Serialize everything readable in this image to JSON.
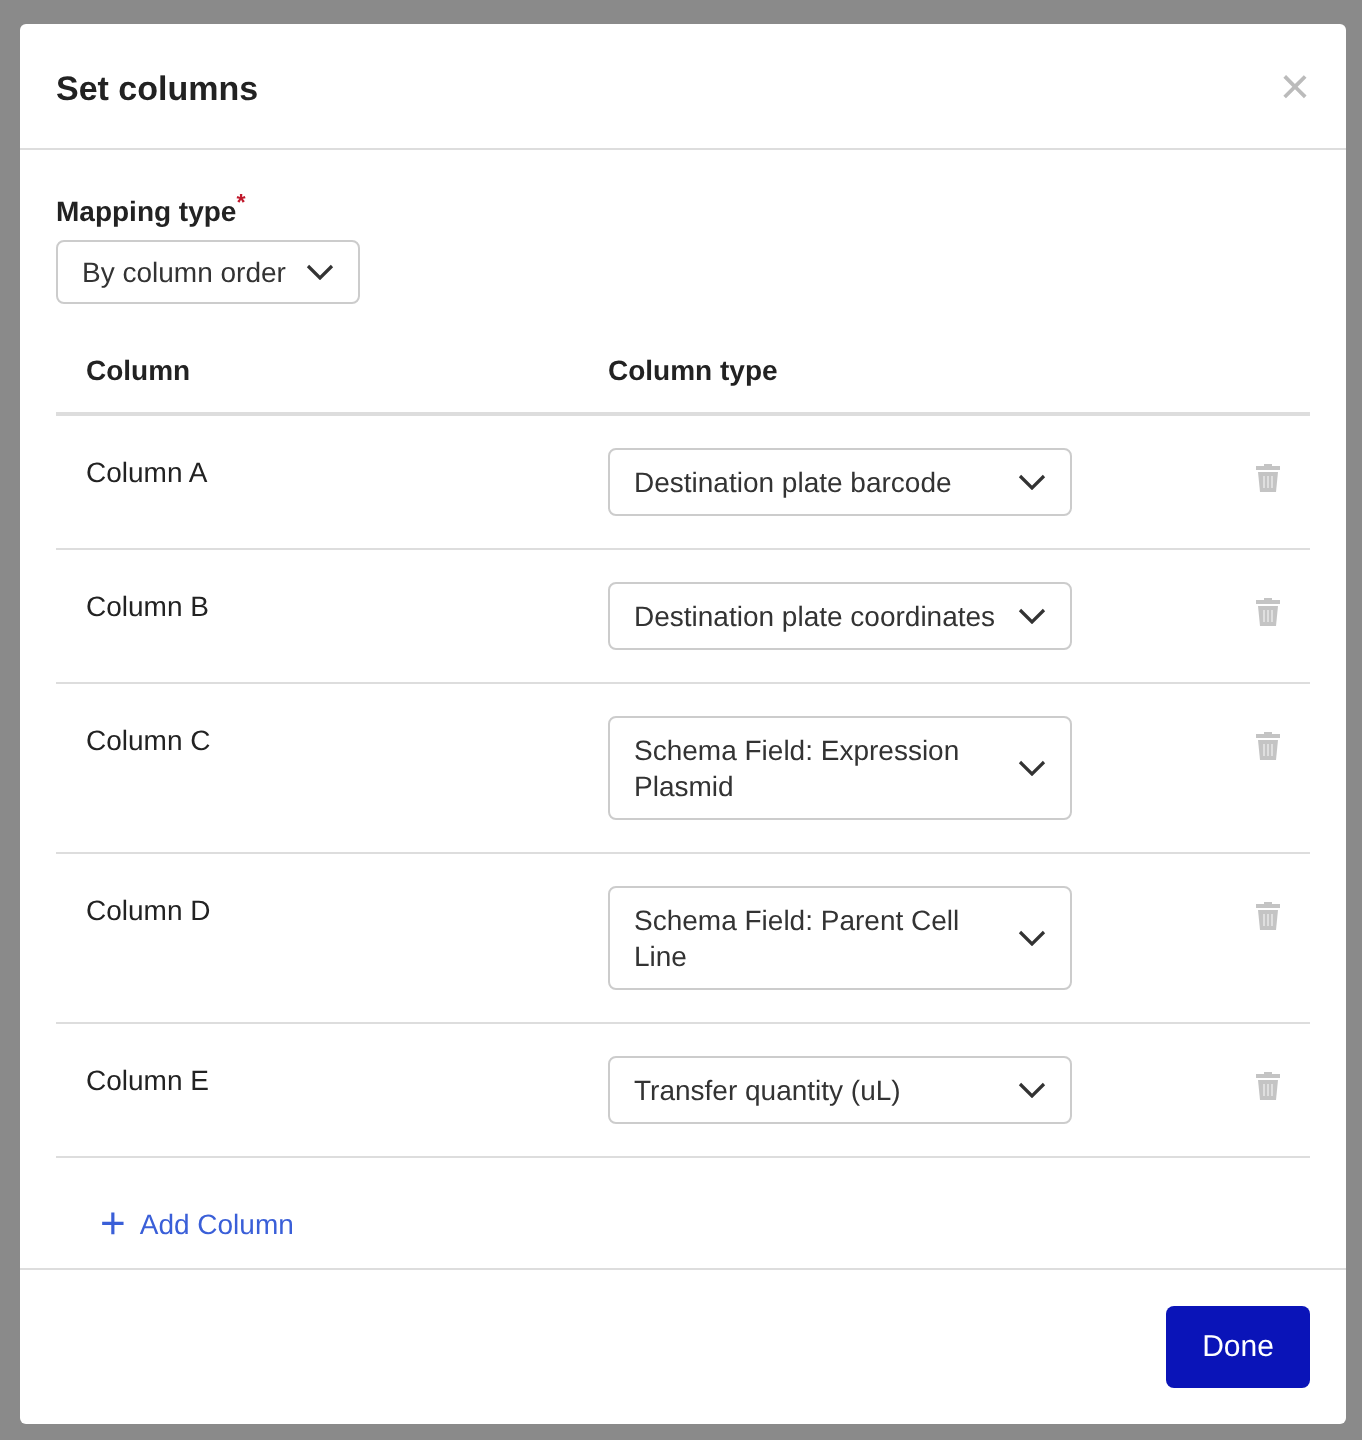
{
  "dialog": {
    "title": "Set columns",
    "close": "×"
  },
  "mapping_type": {
    "label": "Mapping type",
    "required_marker": "*",
    "value": "By column order"
  },
  "table": {
    "columns": [
      "Column",
      "Column type"
    ],
    "rows": [
      {
        "column": "Column A",
        "column_type": "Destination plate barcode"
      },
      {
        "column": "Column B",
        "column_type": "Destination plate coordinates"
      },
      {
        "column": "Column C",
        "column_type": "Schema Field: Expression Plasmid"
      },
      {
        "column": "Column D",
        "column_type": "Schema Field: Parent Cell Line"
      },
      {
        "column": "Column E",
        "column_type": "Transfer quantity (uL)"
      }
    ]
  },
  "add_column": {
    "icon": "+",
    "label": "Add Column"
  },
  "buttons": [
    "Done"
  ]
}
